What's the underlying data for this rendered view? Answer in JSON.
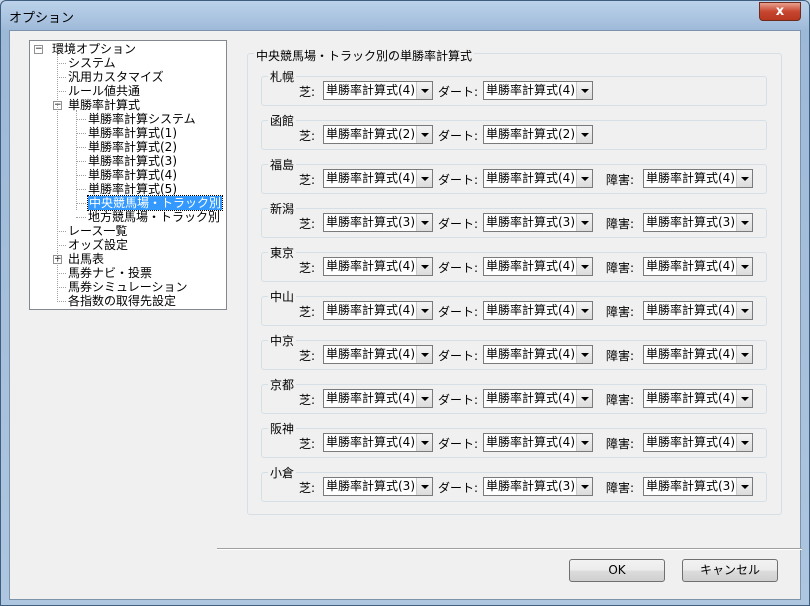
{
  "window": {
    "title": "オプション",
    "close_label": "x"
  },
  "tree": {
    "root": "環境オプション",
    "items": [
      "システム",
      "汎用カスタマイズ",
      "ルール値共通",
      "単勝率計算式"
    ],
    "sub_items": [
      "単勝率計算システム",
      "単勝率計算式(1)",
      "単勝率計算式(2)",
      "単勝率計算式(3)",
      "単勝率計算式(4)",
      "単勝率計算式(5)",
      "中央競馬場・トラック別",
      "地方競馬場・トラック別"
    ],
    "items2": [
      "レース一覧",
      "オッズ設定",
      "出馬表",
      "馬券ナビ・投票",
      "馬券シミュレーション",
      "各指数の取得先設定"
    ],
    "selected": "中央競馬場・トラック別"
  },
  "main": {
    "group_title": "中央競馬場・トラック別の単勝率計算式",
    "turf_label": "芝:",
    "dirt_label": "ダート:",
    "jump_label": "障害:",
    "tracks": [
      {
        "name": "札幌",
        "turf": "単勝率計算式(4)",
        "dirt": "単勝率計算式(4)",
        "jump": null
      },
      {
        "name": "函館",
        "turf": "単勝率計算式(2)",
        "dirt": "単勝率計算式(2)",
        "jump": null
      },
      {
        "name": "福島",
        "turf": "単勝率計算式(4)",
        "dirt": "単勝率計算式(4)",
        "jump": "単勝率計算式(4)"
      },
      {
        "name": "新潟",
        "turf": "単勝率計算式(3)",
        "dirt": "単勝率計算式(3)",
        "jump": "単勝率計算式(3)"
      },
      {
        "name": "東京",
        "turf": "単勝率計算式(4)",
        "dirt": "単勝率計算式(4)",
        "jump": "単勝率計算式(4)"
      },
      {
        "name": "中山",
        "turf": "単勝率計算式(4)",
        "dirt": "単勝率計算式(4)",
        "jump": "単勝率計算式(4)"
      },
      {
        "name": "中京",
        "turf": "単勝率計算式(4)",
        "dirt": "単勝率計算式(4)",
        "jump": "単勝率計算式(4)"
      },
      {
        "name": "京都",
        "turf": "単勝率計算式(4)",
        "dirt": "単勝率計算式(4)",
        "jump": "単勝率計算式(4)"
      },
      {
        "name": "阪神",
        "turf": "単勝率計算式(4)",
        "dirt": "単勝率計算式(4)",
        "jump": "単勝率計算式(4)"
      },
      {
        "name": "小倉",
        "turf": "単勝率計算式(3)",
        "dirt": "単勝率計算式(3)",
        "jump": "単勝率計算式(3)"
      }
    ]
  },
  "buttons": {
    "ok": "OK",
    "cancel": "キャンセル"
  }
}
